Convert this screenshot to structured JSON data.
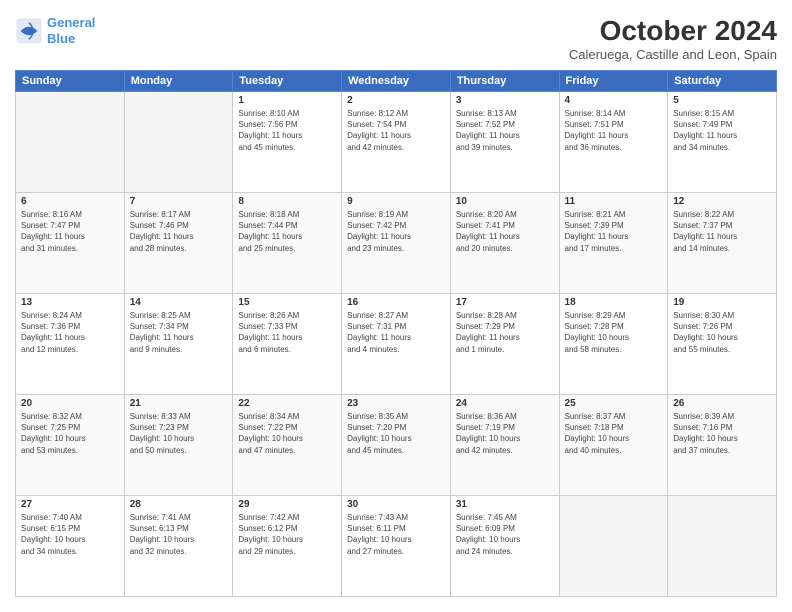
{
  "header": {
    "logo_line1": "General",
    "logo_line2": "Blue",
    "title": "October 2024",
    "subtitle": "Caleruega, Castille and Leon, Spain"
  },
  "days_of_week": [
    "Sunday",
    "Monday",
    "Tuesday",
    "Wednesday",
    "Thursday",
    "Friday",
    "Saturday"
  ],
  "weeks": [
    [
      {
        "day": "",
        "info": ""
      },
      {
        "day": "",
        "info": ""
      },
      {
        "day": "1",
        "info": "Sunrise: 8:10 AM\nSunset: 7:56 PM\nDaylight: 11 hours\nand 45 minutes."
      },
      {
        "day": "2",
        "info": "Sunrise: 8:12 AM\nSunset: 7:54 PM\nDaylight: 11 hours\nand 42 minutes."
      },
      {
        "day": "3",
        "info": "Sunrise: 8:13 AM\nSunset: 7:52 PM\nDaylight: 11 hours\nand 39 minutes."
      },
      {
        "day": "4",
        "info": "Sunrise: 8:14 AM\nSunset: 7:51 PM\nDaylight: 11 hours\nand 36 minutes."
      },
      {
        "day": "5",
        "info": "Sunrise: 8:15 AM\nSunset: 7:49 PM\nDaylight: 11 hours\nand 34 minutes."
      }
    ],
    [
      {
        "day": "6",
        "info": "Sunrise: 8:16 AM\nSunset: 7:47 PM\nDaylight: 11 hours\nand 31 minutes."
      },
      {
        "day": "7",
        "info": "Sunrise: 8:17 AM\nSunset: 7:46 PM\nDaylight: 11 hours\nand 28 minutes."
      },
      {
        "day": "8",
        "info": "Sunrise: 8:18 AM\nSunset: 7:44 PM\nDaylight: 11 hours\nand 25 minutes."
      },
      {
        "day": "9",
        "info": "Sunrise: 8:19 AM\nSunset: 7:42 PM\nDaylight: 11 hours\nand 23 minutes."
      },
      {
        "day": "10",
        "info": "Sunrise: 8:20 AM\nSunset: 7:41 PM\nDaylight: 11 hours\nand 20 minutes."
      },
      {
        "day": "11",
        "info": "Sunrise: 8:21 AM\nSunset: 7:39 PM\nDaylight: 11 hours\nand 17 minutes."
      },
      {
        "day": "12",
        "info": "Sunrise: 8:22 AM\nSunset: 7:37 PM\nDaylight: 11 hours\nand 14 minutes."
      }
    ],
    [
      {
        "day": "13",
        "info": "Sunrise: 8:24 AM\nSunset: 7:36 PM\nDaylight: 11 hours\nand 12 minutes."
      },
      {
        "day": "14",
        "info": "Sunrise: 8:25 AM\nSunset: 7:34 PM\nDaylight: 11 hours\nand 9 minutes."
      },
      {
        "day": "15",
        "info": "Sunrise: 8:26 AM\nSunset: 7:33 PM\nDaylight: 11 hours\nand 6 minutes."
      },
      {
        "day": "16",
        "info": "Sunrise: 8:27 AM\nSunset: 7:31 PM\nDaylight: 11 hours\nand 4 minutes."
      },
      {
        "day": "17",
        "info": "Sunrise: 8:28 AM\nSunset: 7:29 PM\nDaylight: 11 hours\nand 1 minute."
      },
      {
        "day": "18",
        "info": "Sunrise: 8:29 AM\nSunset: 7:28 PM\nDaylight: 10 hours\nand 58 minutes."
      },
      {
        "day": "19",
        "info": "Sunrise: 8:30 AM\nSunset: 7:26 PM\nDaylight: 10 hours\nand 55 minutes."
      }
    ],
    [
      {
        "day": "20",
        "info": "Sunrise: 8:32 AM\nSunset: 7:25 PM\nDaylight: 10 hours\nand 53 minutes."
      },
      {
        "day": "21",
        "info": "Sunrise: 8:33 AM\nSunset: 7:23 PM\nDaylight: 10 hours\nand 50 minutes."
      },
      {
        "day": "22",
        "info": "Sunrise: 8:34 AM\nSunset: 7:22 PM\nDaylight: 10 hours\nand 47 minutes."
      },
      {
        "day": "23",
        "info": "Sunrise: 8:35 AM\nSunset: 7:20 PM\nDaylight: 10 hours\nand 45 minutes."
      },
      {
        "day": "24",
        "info": "Sunrise: 8:36 AM\nSunset: 7:19 PM\nDaylight: 10 hours\nand 42 minutes."
      },
      {
        "day": "25",
        "info": "Sunrise: 8:37 AM\nSunset: 7:18 PM\nDaylight: 10 hours\nand 40 minutes."
      },
      {
        "day": "26",
        "info": "Sunrise: 8:39 AM\nSunset: 7:16 PM\nDaylight: 10 hours\nand 37 minutes."
      }
    ],
    [
      {
        "day": "27",
        "info": "Sunrise: 7:40 AM\nSunset: 6:15 PM\nDaylight: 10 hours\nand 34 minutes."
      },
      {
        "day": "28",
        "info": "Sunrise: 7:41 AM\nSunset: 6:13 PM\nDaylight: 10 hours\nand 32 minutes."
      },
      {
        "day": "29",
        "info": "Sunrise: 7:42 AM\nSunset: 6:12 PM\nDaylight: 10 hours\nand 29 minutes."
      },
      {
        "day": "30",
        "info": "Sunrise: 7:43 AM\nSunset: 6:11 PM\nDaylight: 10 hours\nand 27 minutes."
      },
      {
        "day": "31",
        "info": "Sunrise: 7:45 AM\nSunset: 6:09 PM\nDaylight: 10 hours\nand 24 minutes."
      },
      {
        "day": "",
        "info": ""
      },
      {
        "day": "",
        "info": ""
      }
    ]
  ]
}
